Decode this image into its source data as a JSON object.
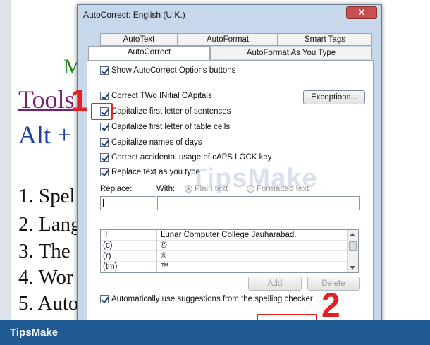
{
  "document": {
    "heading_m": "M",
    "tools": "Tools",
    "alt": "Alt +",
    "list_items": [
      "1. Spel",
      "2. Lang",
      "3. The",
      "4. Wor",
      "5. Auto"
    ]
  },
  "dialog": {
    "title": "AutoCorrect: English (U.K.)",
    "close_symbol": "✕",
    "tabs_top": [
      "AutoText",
      "AutoFormat",
      "Smart Tags"
    ],
    "tabs_bottom": [
      "AutoCorrect",
      "AutoFormat As You Type"
    ],
    "active_tab": "AutoCorrect",
    "options": {
      "show_buttons": "Show AutoCorrect Options buttons",
      "correct_two_initials": "Correct TWo INitial CApitals",
      "capitalize_sentences": "Capitalize first letter of sentences",
      "capitalize_table_cells": "Capitalize first letter of table cells",
      "capitalize_days": "Capitalize names of days",
      "correct_caps_lock": "Correct accidental usage of cAPS LOCK key",
      "replace_as_you_type": "Replace text as you type",
      "use_spelling_suggestions": "Automatically use suggestions from the spelling checker"
    },
    "exceptions_label": "Exceptions...",
    "replace_label": "Replace:",
    "with_label": "With:",
    "plain_text_label": "Plain text",
    "formatted_text_label": "Formatted text",
    "list": [
      {
        "key": "!!",
        "value": "Lunar Computer College Jauharabad."
      },
      {
        "key": "(c)",
        "value": "©"
      },
      {
        "key": "(r)",
        "value": "®"
      },
      {
        "key": "(tm)",
        "value": "™"
      }
    ],
    "add_label": "Add",
    "delete_label": "Delete"
  },
  "annotations": {
    "step1": "1",
    "step2": "2",
    "color": "#e02222"
  },
  "watermark": "TipsMake",
  "footer": {
    "logo": "TipsMake",
    "color": "#1f5a93"
  }
}
